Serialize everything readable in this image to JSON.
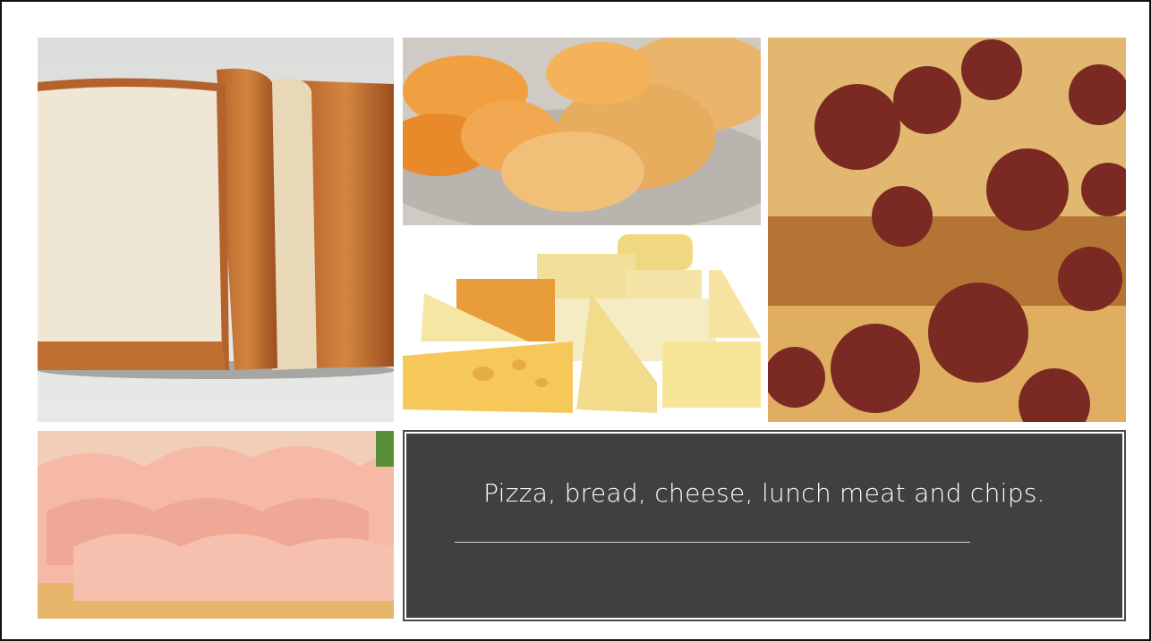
{
  "slide": {
    "caption": "Pizza, bread, cheese, lunch meat and chips.",
    "colors": {
      "caption_bg": "#404040",
      "caption_text": "#ffffff",
      "page_bg": "#ffffff"
    }
  },
  "images": [
    {
      "name": "bread-photo"
    },
    {
      "name": "chips-photo"
    },
    {
      "name": "cheese-photo"
    },
    {
      "name": "pizza-photo"
    },
    {
      "name": "lunch-meat-photo"
    }
  ]
}
